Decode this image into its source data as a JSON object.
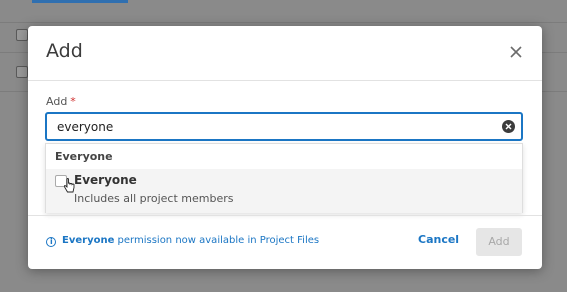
{
  "dialog": {
    "title": "Add",
    "field_label": "Add",
    "required_mark": "*",
    "input_value": "everyone",
    "suggestions": {
      "group_header": "Everyone",
      "options": [
        {
          "name": "Everyone",
          "description": "Includes all project members",
          "checked": false
        }
      ]
    },
    "footer": {
      "info_bold": "Everyone",
      "info_rest": " permission now available in Project Files",
      "cancel_label": "Cancel",
      "add_label": "Add"
    }
  },
  "colors": {
    "accent": "#1b76c4",
    "required": "#d0302f",
    "overlay": "#8a8a8a"
  }
}
